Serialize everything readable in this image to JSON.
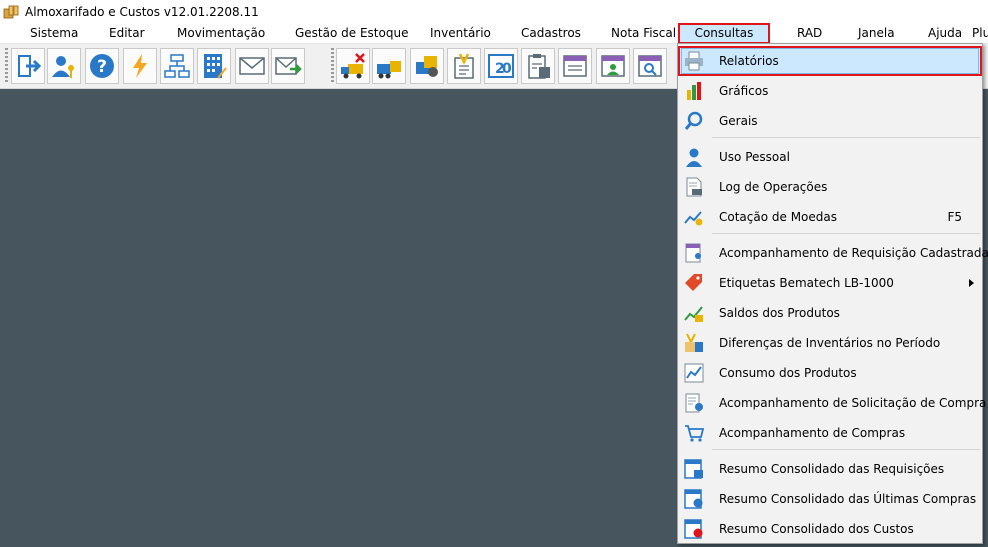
{
  "window": {
    "title": "Almoxarifado e Custos v12.01.2208.11",
    "icon": "package-icon"
  },
  "menubar": {
    "items": [
      {
        "id": "sistema",
        "label": "Sistema"
      },
      {
        "id": "editar",
        "label": "Editar"
      },
      {
        "id": "movimentacao",
        "label": "Movimentação"
      },
      {
        "id": "gestao",
        "label": "Gestão de Estoque"
      },
      {
        "id": "inventario",
        "label": "Inventário"
      },
      {
        "id": "cadastros",
        "label": "Cadastros"
      },
      {
        "id": "nota-fiscal",
        "label": "Nota Fiscal"
      },
      {
        "id": "consultas",
        "label": "Consultas",
        "active": true
      },
      {
        "id": "rad",
        "label": "RAD"
      },
      {
        "id": "janela",
        "label": "Janela"
      },
      {
        "id": "ajuda",
        "label": "Ajuda"
      },
      {
        "id": "plugins",
        "label": "Plu"
      }
    ]
  },
  "toolbar": {
    "buttons": [
      "exit-icon",
      "user-key-icon",
      "help-icon",
      "lightning-icon",
      "org-chart-icon",
      "calculator-icon",
      "email-icon",
      "email-send-icon",
      "truck-cancel-icon",
      "truck-box-icon",
      "transfer-icon",
      "inventory-tools-icon",
      "counter-icon",
      "clipboard-check-icon",
      "schedule-icon",
      "report-user-icon",
      "search-report-icon"
    ]
  },
  "consultas_menu": {
    "items": [
      {
        "label": "Relatórios",
        "icon": "printer-icon",
        "highlighted": true
      },
      {
        "label": "Gráficos",
        "icon": "bar-chart-icon"
      },
      {
        "label": "Gerais",
        "icon": "magnifier-icon"
      },
      {
        "separator": true
      },
      {
        "label": "Uso Pessoal",
        "icon": "person-icon"
      },
      {
        "label": "Log de Operações",
        "icon": "log-document-icon"
      },
      {
        "label": "Cotação de Moedas",
        "icon": "currency-chart-icon",
        "shortcut": "F5"
      },
      {
        "separator": true
      },
      {
        "label": "Acompanhamento de Requisição Cadastrada",
        "icon": "requisition-icon"
      },
      {
        "label": "Etiquetas Bematech LB-1000",
        "icon": "price-tag-icon",
        "submenu": true
      },
      {
        "label": "Saldos dos Produtos",
        "icon": "balance-chart-icon"
      },
      {
        "label": "Diferenças de Inventários no Período",
        "icon": "inventory-diff-icon"
      },
      {
        "label": "Consumo dos Produtos",
        "icon": "consumption-chart-icon"
      },
      {
        "label": "Acompanhamento de Solicitação de Compra",
        "icon": "purchase-request-icon"
      },
      {
        "label": "Acompanhamento de Compras",
        "icon": "shopping-cart-icon"
      },
      {
        "separator": true
      },
      {
        "label": "Resumo Consolidado das Requisições",
        "icon": "summary-requisition-icon"
      },
      {
        "label": "Resumo Consolidado das Últimas Compras",
        "icon": "summary-purchase-icon"
      },
      {
        "label": "Resumo Consolidado dos Custos",
        "icon": "summary-cost-icon"
      }
    ]
  },
  "colors": {
    "workspace": "#46555e",
    "highlight": "#cce8ff",
    "focus_border": "#e0141b",
    "menu_bg": "#f2f2f2"
  }
}
